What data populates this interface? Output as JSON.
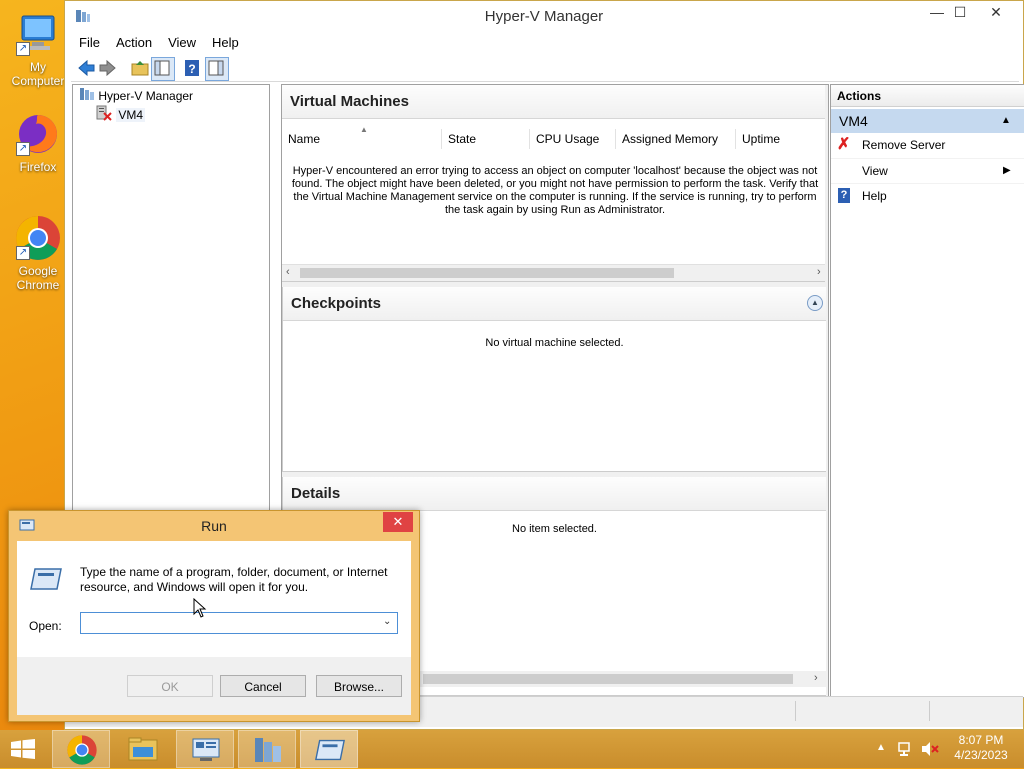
{
  "desktop": {
    "icons": [
      {
        "label": "My Computer"
      },
      {
        "label": "Firefox"
      },
      {
        "label": "Google Chrome"
      }
    ]
  },
  "window": {
    "title": "Hyper-V Manager",
    "menu": [
      "File",
      "Action",
      "View",
      "Help"
    ]
  },
  "tree": {
    "root": "Hyper-V Manager",
    "child": "VM4"
  },
  "virtual_machines": {
    "header": "Virtual Machines",
    "columns": [
      "Name",
      "State",
      "CPU Usage",
      "Assigned Memory",
      "Uptime"
    ],
    "error": "Hyper-V encountered an error trying to access an object on computer 'localhost' because the object was not found. The object might have been deleted, or you might not have permission to perform the task. Verify that the Virtual Machine Management service on the computer is running. If the service is running, try to perform the task again by using Run as Administrator."
  },
  "checkpoints": {
    "header": "Checkpoints",
    "empty": "No virtual machine selected."
  },
  "details": {
    "header": "Details",
    "empty": "No item selected."
  },
  "actions": {
    "header": "Actions",
    "group": "VM4",
    "items": [
      "Remove Server",
      "View",
      "Help"
    ]
  },
  "run": {
    "title": "Run",
    "description": "Type the name of a program, folder, document, or Internet resource, and Windows will open it for you.",
    "open_label": "Open:",
    "open_value": "",
    "ok": "OK",
    "cancel": "Cancel",
    "browse": "Browse..."
  },
  "taskbar": {
    "time": "8:07 PM",
    "date": "4/23/2023"
  },
  "colors": {
    "accent_selected": "#c5d9ef",
    "run_border": "#f4c574",
    "close_red": "#e04343"
  }
}
